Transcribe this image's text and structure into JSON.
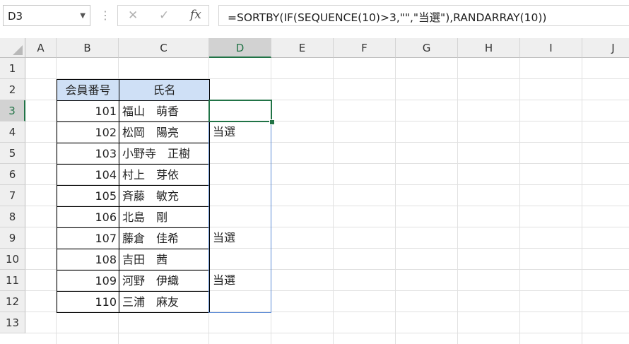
{
  "formula_bar": {
    "name_box": "D3",
    "cancel_icon": "✕",
    "enter_icon": "✓",
    "fx_label": "fx",
    "formula": "=SORTBY(IF(SEQUENCE(10)>3,\"\",\"当選\"),RANDARRAY(10))"
  },
  "columns": [
    "A",
    "B",
    "C",
    "D",
    "E",
    "F",
    "G",
    "H",
    "I",
    "J"
  ],
  "active_column": "D",
  "rows": [
    "1",
    "2",
    "3",
    "4",
    "5",
    "6",
    "7",
    "8",
    "9",
    "10",
    "11",
    "12",
    "13"
  ],
  "active_row": "3",
  "table": {
    "headers": [
      "会員番号",
      "氏名"
    ],
    "records": [
      {
        "id": "101",
        "name": "福山　萌香",
        "result": ""
      },
      {
        "id": "102",
        "name": "松岡　陽亮",
        "result": "当選"
      },
      {
        "id": "103",
        "name": "小野寺　正樹",
        "result": ""
      },
      {
        "id": "104",
        "name": "村上　芽依",
        "result": ""
      },
      {
        "id": "105",
        "name": "斉藤　敏充",
        "result": ""
      },
      {
        "id": "106",
        "name": "北島　剛",
        "result": ""
      },
      {
        "id": "107",
        "name": "藤倉　佳希",
        "result": "当選"
      },
      {
        "id": "108",
        "name": "吉田　茜",
        "result": ""
      },
      {
        "id": "109",
        "name": "河野　伊織",
        "result": "当選"
      },
      {
        "id": "110",
        "name": "三浦　麻友",
        "result": ""
      }
    ]
  },
  "colors": {
    "accent": "#217346",
    "header_fill": "#cfe0f6",
    "spill_border": "#5b8bd6"
  }
}
